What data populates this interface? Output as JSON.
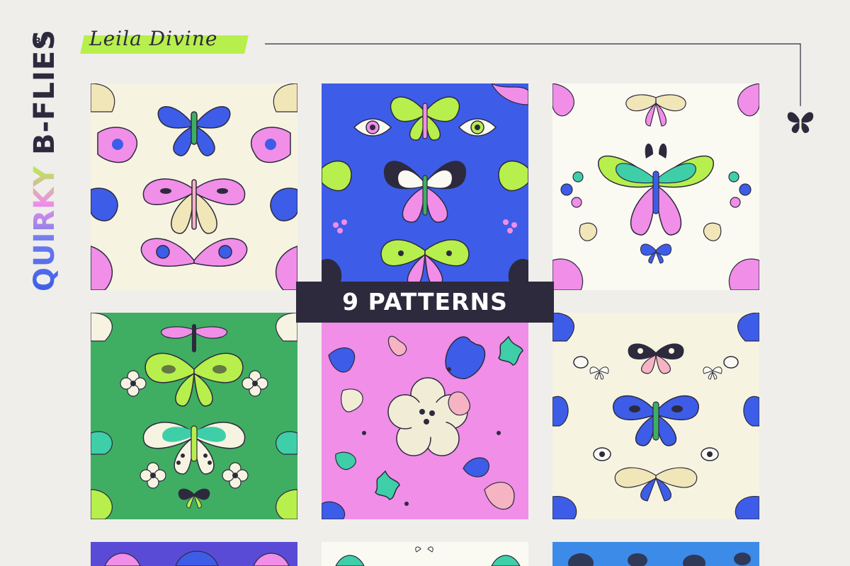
{
  "header": {
    "by_label": "BY",
    "author": "Leila Divine"
  },
  "title": {
    "word1": "QUIRKY",
    "word2": "B-FLIES"
  },
  "banner": {
    "label": "9 PATTERNS"
  },
  "colors": {
    "background": "#efeeea",
    "ink": "#2d2a3e",
    "lime": "#b7ef4c",
    "blue": "#3d5de8",
    "pink": "#f08ee8",
    "green": "#3fae62",
    "cream": "#f6f4e1"
  },
  "patterns": [
    {
      "name": "cream-butterflies",
      "bg": "#f6f4e1"
    },
    {
      "name": "blue-eyes",
      "bg": "#3d5de8"
    },
    {
      "name": "white-teal-butterflies",
      "bg": "#fbfaf2"
    },
    {
      "name": "green-moths",
      "bg": "#3fae62"
    },
    {
      "name": "pink-florals",
      "bg": "#f08ee8"
    },
    {
      "name": "cream-small-butterflies",
      "bg": "#f6f4e1"
    },
    {
      "name": "purple-partial",
      "bg": "#5a4bd6"
    },
    {
      "name": "white-partial",
      "bg": "#fbfaf2"
    },
    {
      "name": "sky-partial",
      "bg": "#3d8be8"
    }
  ]
}
